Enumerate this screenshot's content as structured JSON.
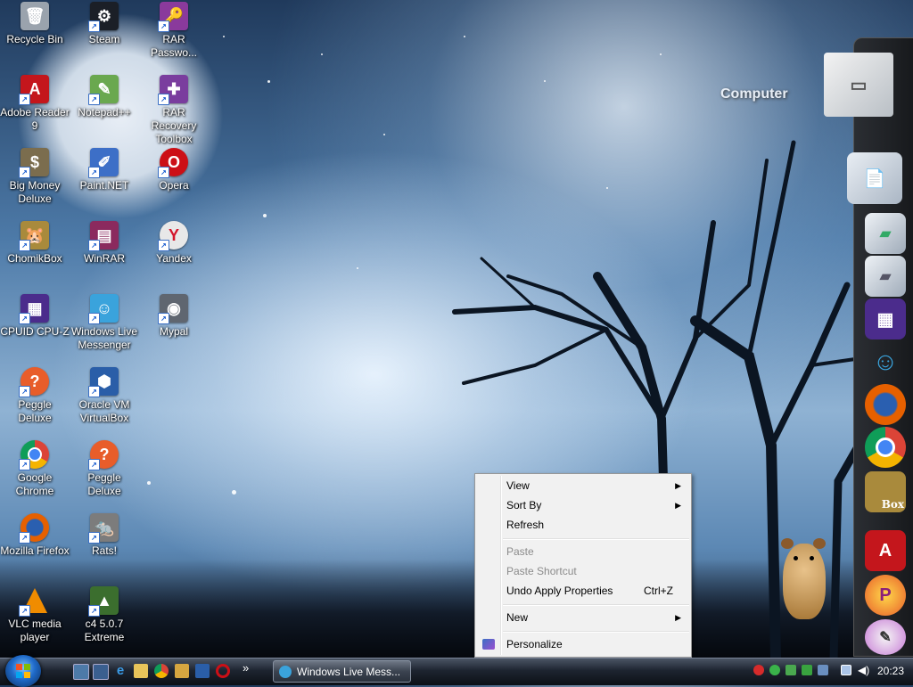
{
  "desktop": {
    "icons": [
      {
        "label": "Recycle Bin",
        "glyph": "recycle-bin-icon",
        "color": "#9aa3ad"
      },
      {
        "label": "Steam",
        "glyph": "steam-icon",
        "color": "#1b1f27"
      },
      {
        "label": "RAR Passwo...",
        "glyph": "rar-password-icon",
        "color": "#8a3a9c"
      },
      {
        "label": "Adobe Reader 9",
        "glyph": "adobe-reader-icon",
        "color": "#c4161c"
      },
      {
        "label": "Notepad++",
        "glyph": "notepad-plus-icon",
        "color": "#6aa84f"
      },
      {
        "label": "RAR Recovery Toolbox",
        "glyph": "rar-recovery-icon",
        "color": "#7a3d9e"
      },
      {
        "label": "Big Money Deluxe",
        "glyph": "big-money-icon",
        "color": "#7b6d4e"
      },
      {
        "label": "Paint.NET",
        "glyph": "paint-net-icon",
        "color": "#3d6fc7"
      },
      {
        "label": "Opera",
        "glyph": "opera-icon",
        "color": "#cc0f16"
      },
      {
        "label": "ChomikBox",
        "glyph": "chomikbox-icon",
        "color": "#a98a3c"
      },
      {
        "label": "WinRAR",
        "glyph": "winrar-icon",
        "color": "#8b2a5e"
      },
      {
        "label": "Yandex",
        "glyph": "yandex-icon",
        "color": "#e8e8e8"
      },
      {
        "label": "CPUID CPU-Z",
        "glyph": "cpuz-icon",
        "color": "#4b2c8c"
      },
      {
        "label": "Windows Live Messenger",
        "glyph": "messenger-icon",
        "color": "#3aa3dc"
      },
      {
        "label": "Mypal",
        "glyph": "mypal-icon",
        "color": "#5f6670"
      },
      {
        "label": "Peggle Deluxe",
        "glyph": "peggle-icon",
        "color": "#e85d2a"
      },
      {
        "label": "Oracle VM VirtualBox",
        "glyph": "virtualbox-icon",
        "color": "#2a5ea8"
      },
      {
        "label": "Google Chrome",
        "glyph": "chrome-icon",
        "color": "#db4437"
      },
      {
        "label": "Peggle Deluxe",
        "glyph": "peggle-icon",
        "color": "#e85d2a"
      },
      {
        "label": "Mozilla Firefox",
        "glyph": "firefox-icon",
        "color": "#e66000"
      },
      {
        "label": "Rats!",
        "glyph": "rats-icon",
        "color": "#7c7c7c"
      },
      {
        "label": "VLC media player",
        "glyph": "vlc-icon",
        "color": "#f08c00"
      },
      {
        "label": "c4 5.0.7 Extreme",
        "glyph": "c4-icon",
        "color": "#3b6e2e"
      }
    ],
    "computer_label": "Computer"
  },
  "dock": {
    "items": [
      "computer-icon",
      "documents-folder-icon",
      "folder-icon",
      "folder-icon-2",
      "cpuz-icon",
      "messenger-icon",
      "firefox-icon",
      "chrome-icon",
      "chomikbox-icon",
      "adobe-reader-icon",
      "peggle-icon",
      "paint-icon"
    ],
    "chomikbox_text": "Box"
  },
  "context_menu": {
    "view": "View",
    "sort_by": "Sort By",
    "refresh": "Refresh",
    "paste": "Paste",
    "paste_shortcut": "Paste Shortcut",
    "undo": "Undo Apply Properties",
    "undo_shortcut": "Ctrl+Z",
    "new": "New",
    "personalize": "Personalize",
    "submenu_arrow": "▶"
  },
  "taskbar": {
    "quick_launch": [
      "show-desktop-icon",
      "switch-windows-icon",
      "ie-icon",
      "folder-icon",
      "chrome-icon",
      "volume-icon",
      "virtualbox-icon",
      "opera-icon"
    ],
    "overflow": "»",
    "task_button": "Windows Live Mess...",
    "clock": "20:23"
  },
  "colors": {
    "accent": "#1f6ac9",
    "menu_bg": "#f1f1f1",
    "disabled": "#8b8b8b"
  }
}
